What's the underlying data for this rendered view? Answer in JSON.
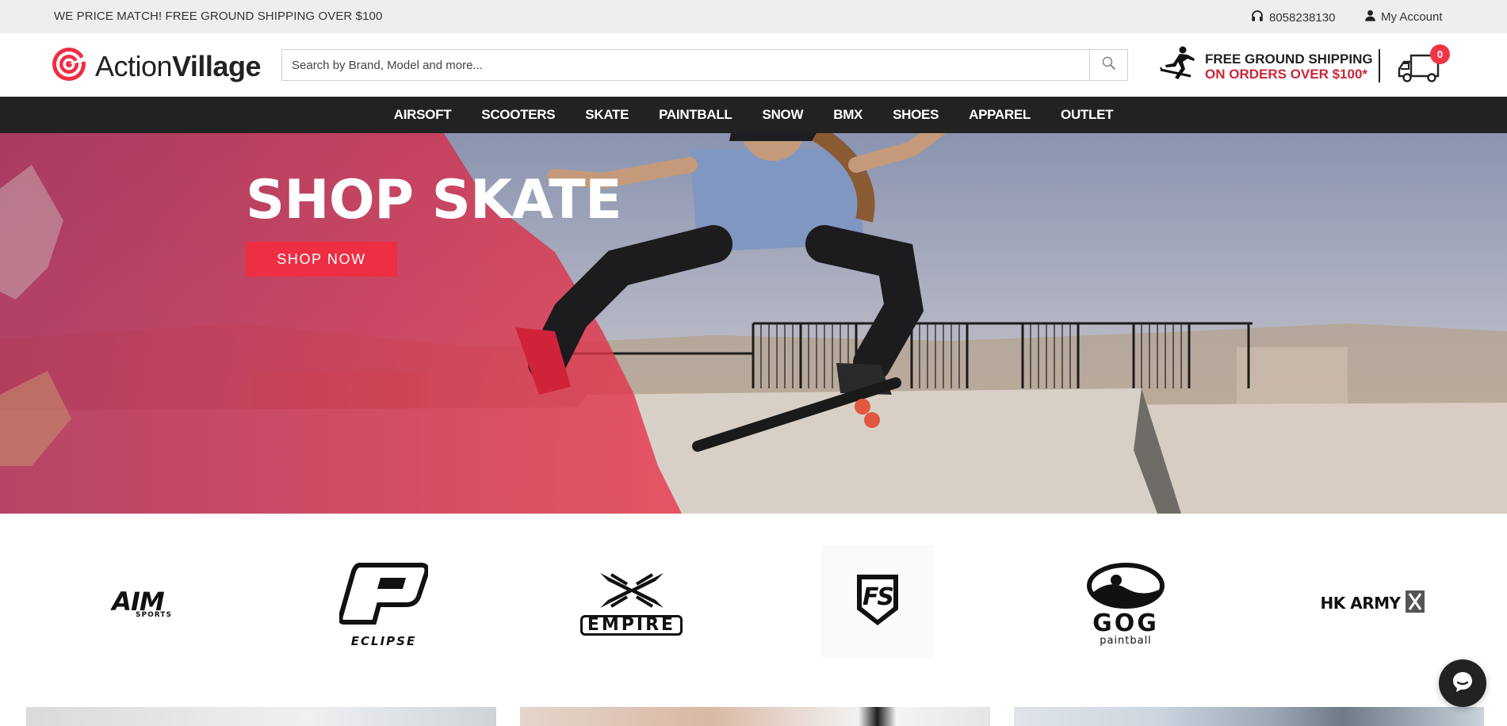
{
  "topbar": {
    "promo": "WE PRICE MATCH! FREE GROUND SHIPPING OVER $100",
    "phone": "8058238130",
    "account": "My Account"
  },
  "header": {
    "logo_light": "Action",
    "logo_bold": "Village",
    "search_placeholder": "Search by Brand, Model and more...",
    "shipping_line1": "FREE GROUND SHIPPING",
    "shipping_line2": "ON ORDERS OVER $100*",
    "cart_count": "0"
  },
  "nav": {
    "items": [
      {
        "label": "AIRSOFT"
      },
      {
        "label": "SCOOTERS"
      },
      {
        "label": "SKATE"
      },
      {
        "label": "PAINTBALL"
      },
      {
        "label": "SNOW"
      },
      {
        "label": "BMX"
      },
      {
        "label": "SHOES"
      },
      {
        "label": "APPAREL"
      },
      {
        "label": "OUTLET"
      }
    ]
  },
  "hero": {
    "title": "SHOP SKATE",
    "cta": "SHOP NOW"
  },
  "brands": {
    "items": [
      {
        "label": "AIM",
        "sub": "SPORTS"
      },
      {
        "label": "ECLIPSE"
      },
      {
        "label": "EMPIRE"
      },
      {
        "label": "FS"
      },
      {
        "label": "GOG",
        "sub": "paintball"
      },
      {
        "label": "HK ARMY"
      }
    ]
  },
  "colors": {
    "accent": "#ee2e43",
    "nav_bg": "#222222",
    "topbar_bg": "#efeeef",
    "shipping_red": "#c8283a"
  },
  "icons": {
    "phone": "headset-icon",
    "account": "user-icon",
    "search": "search-icon",
    "shipping": "skater-icon",
    "cart": "delivery-truck-icon",
    "chat": "chat-bubble-icon"
  }
}
